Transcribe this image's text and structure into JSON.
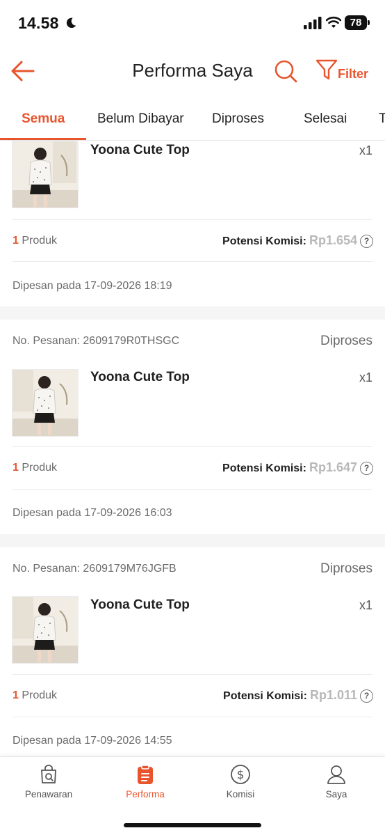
{
  "status_bar": {
    "time": "14.58",
    "battery": "78"
  },
  "header": {
    "title": "Performa Saya",
    "filter_label": "Filter"
  },
  "tabs": [
    {
      "label": "Semua"
    },
    {
      "label": "Belum Dibayar"
    },
    {
      "label": "Diproses"
    },
    {
      "label": "Selesai"
    },
    {
      "label": "T"
    }
  ],
  "orders": [
    {
      "product_name": "Yoona Cute Top",
      "qty": "x1",
      "product_count": "1",
      "product_count_label": "Produk",
      "komisi_label": "Potensi Komisi:",
      "komisi_value": "Rp1.654",
      "ordered_at": "Dipesan pada 17-09-2026 18:19"
    },
    {
      "order_no": "No. Pesanan: 2609179R0THSGC",
      "status": "Diproses",
      "product_name": "Yoona Cute Top",
      "qty": "x1",
      "product_count": "1",
      "product_count_label": "Produk",
      "komisi_label": "Potensi Komisi:",
      "komisi_value": "Rp1.647",
      "ordered_at": "Dipesan pada 17-09-2026 16:03"
    },
    {
      "order_no": "No. Pesanan: 2609179M76JGFB",
      "status": "Diproses",
      "product_name": "Yoona Cute Top",
      "qty": "x1",
      "product_count": "1",
      "product_count_label": "Produk",
      "komisi_label": "Potensi Komisi:",
      "komisi_value": "Rp1.011",
      "ordered_at": "Dipesan pada 17-09-2026 14:55"
    }
  ],
  "help_glyph": "?",
  "bottom_nav": [
    {
      "label": "Penawaran",
      "icon": "bag-icon"
    },
    {
      "label": "Performa",
      "icon": "clipboard-icon"
    },
    {
      "label": "Komisi",
      "icon": "dollar-circle-icon"
    },
    {
      "label": "Saya",
      "icon": "user-icon"
    }
  ],
  "colors": {
    "accent": "#e8552d",
    "muted_text": "#6b6b6b",
    "komisi_amount": "#b8b8b8"
  }
}
